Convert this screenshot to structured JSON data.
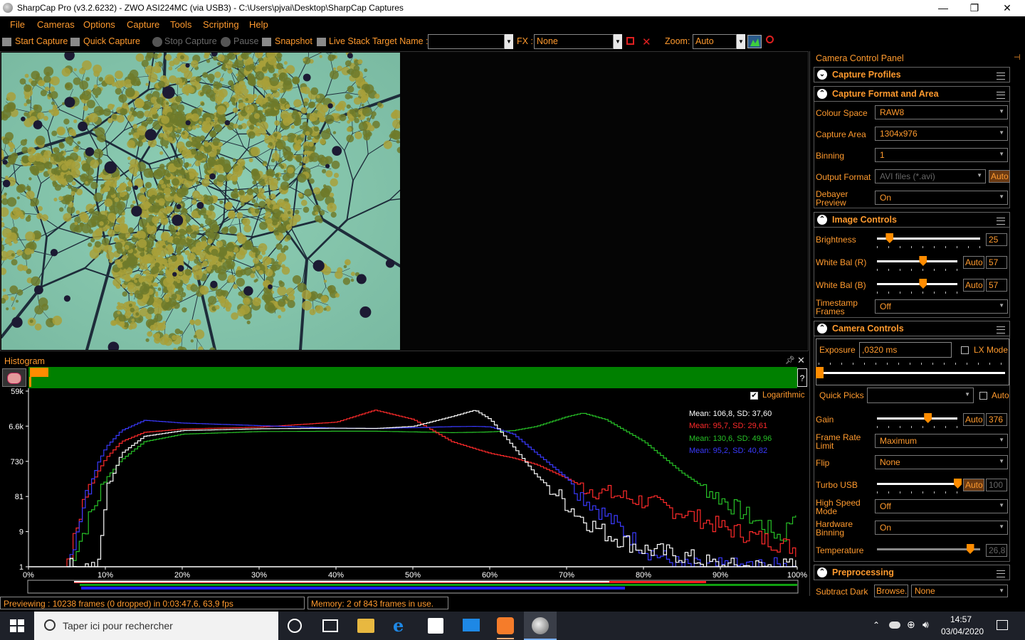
{
  "window": {
    "title": "SharpCap Pro (v3.2.6232) - ZWO ASI224MC (via USB3) - C:\\Users\\pjvai\\Desktop\\SharpCap Captures",
    "min_glyph": "—",
    "max_glyph": "❐",
    "close_glyph": "✕"
  },
  "menu": [
    "File",
    "Cameras",
    "Options",
    "Capture",
    "Tools",
    "Scripting",
    "Help"
  ],
  "toolbar": {
    "start_capture": "Start Capture",
    "quick_capture": "Quick Capture",
    "stop_capture": "Stop Capture",
    "pause": "Pause",
    "snapshot": "Snapshot",
    "live_stack": "Live Stack",
    "target_name_label": "Target Name :",
    "target_name_value": "",
    "fx_label": "FX :",
    "fx_value": "None",
    "zoom_label": "Zoom:",
    "zoom_value": "Auto"
  },
  "histogram": {
    "title": "Histogram",
    "help": "?",
    "logarithmic_label": "Logarithmic",
    "logarithmic_checked": true,
    "y_ticks": [
      "59k",
      "6.6k",
      "730",
      "81",
      "9",
      "1"
    ],
    "x_ticks": [
      "0%",
      "10%",
      "20%",
      "30%",
      "40%",
      "50%",
      "60%",
      "70%",
      "80%",
      "90%",
      "100%"
    ],
    "stats": [
      {
        "text": "Mean: 106,8, SD: 37,60",
        "color": "#ffffff"
      },
      {
        "text": "Mean: 95,7, SD: 29,61",
        "color": "#ff2a2a"
      },
      {
        "text": "Mean: 130,6, SD: 49,96",
        "color": "#27c227"
      },
      {
        "text": "Mean: 95,2, SD: 40,82",
        "color": "#3a3aff"
      }
    ]
  },
  "chart_data": {
    "type": "line",
    "xlabel": "",
    "ylabel": "",
    "x_unit": "%",
    "y_scale": "log",
    "xlim": [
      0,
      100
    ],
    "ylim": [
      1,
      59000
    ],
    "x": [
      5,
      7,
      9,
      10,
      12,
      15,
      20,
      30,
      40,
      45,
      50,
      55,
      58,
      60,
      63,
      66,
      70,
      72,
      75,
      80,
      85,
      90,
      95,
      98,
      100
    ],
    "series": [
      {
        "name": "L",
        "color": "#ffffff",
        "values": [
          1,
          1,
          1,
          100,
          1200,
          3500,
          5000,
          5600,
          5800,
          5700,
          6500,
          12000,
          18000,
          10000,
          1800,
          300,
          50,
          20,
          8,
          3,
          2,
          1,
          1,
          1,
          1
        ]
      },
      {
        "name": "R",
        "color": "#ff2a2a",
        "values": [
          1,
          60,
          400,
          900,
          2500,
          4500,
          5500,
          6200,
          8500,
          18000,
          10000,
          2500,
          1600,
          1200,
          900,
          600,
          250,
          150,
          100,
          60,
          30,
          12,
          6,
          4,
          3
        ]
      },
      {
        "name": "G",
        "color": "#27c227",
        "values": [
          1,
          8,
          80,
          250,
          800,
          2500,
          4000,
          4700,
          4800,
          4800,
          4600,
          4400,
          4500,
          4600,
          5000,
          6500,
          12000,
          15000,
          10000,
          2500,
          350,
          70,
          15,
          6,
          50
        ]
      },
      {
        "name": "B",
        "color": "#3a3aff",
        "values": [
          1,
          50,
          700,
          1800,
          5000,
          9500,
          8000,
          6800,
          5800,
          5700,
          6000,
          6400,
          6500,
          6300,
          4000,
          1200,
          250,
          80,
          25,
          3,
          1,
          1,
          1,
          1,
          1
        ]
      }
    ]
  },
  "status": {
    "previewing": "Previewing : 10238 frames (0 dropped) in 0:03:47,6, 63,9 fps",
    "memory": "Memory: 2 of 843 frames in use."
  },
  "panel": {
    "title": "Camera Control Panel",
    "capture_profiles": "Capture Profiles",
    "capture_format": "Capture Format and Area",
    "colour_space_label": "Colour Space",
    "colour_space": "RAW8",
    "capture_area_label": "Capture Area",
    "capture_area": "1304x976",
    "binning_label": "Binning",
    "binning": "1",
    "output_format_label": "Output Format",
    "output_format": "AVI files (*.avi)",
    "output_auto": "Auto",
    "debayer_label_1": "Debayer",
    "debayer_label_2": "Preview",
    "debayer": "On",
    "image_controls": "Image Controls",
    "brightness_label": "Brightness",
    "brightness": "25",
    "brightness_level": 0.12,
    "wb_r_label": "White Bal (R)",
    "wb_r": "57",
    "wb_r_level": 0.57,
    "wb_b_label": "White Bal (B)",
    "wb_b": "57",
    "wb_b_level": 0.57,
    "auto": "Auto",
    "timestamp_label_1": "Timestamp",
    "timestamp_label_2": "Frames",
    "timestamp": "Off",
    "camera_controls": "Camera Controls",
    "exposure_label": "Exposure",
    "exposure": ",0320 ms",
    "lx_mode": "LX Mode",
    "quick_picks": "Quick Picks",
    "quick_picks_auto": "Auto",
    "gain_label": "Gain",
    "gain": "376",
    "gain_level": 0.63,
    "frame_rate_label_1": "Frame Rate",
    "frame_rate_label_2": "Limit",
    "frame_rate": "Maximum",
    "flip_label": "Flip",
    "flip": "None",
    "turbo_label": "Turbo USB",
    "turbo": "100",
    "turbo_level": 1.0,
    "high_speed_label_1": "High Speed",
    "high_speed_label_2": "Mode",
    "high_speed": "Off",
    "hw_binning_label_1": "Hardware",
    "hw_binning_label_2": "Binning",
    "hw_binning": "On",
    "temperature_label": "Temperature",
    "temperature": "26,8",
    "temperature_level": 0.9,
    "preprocessing": "Preprocessing",
    "subtract_dark_label": "Subtract Dark",
    "browse": "Browse...",
    "subtract_dark": "None"
  },
  "taskbar": {
    "search_placeholder": "Taper ici pour rechercher",
    "time": "14:57",
    "date": "03/04/2020"
  }
}
